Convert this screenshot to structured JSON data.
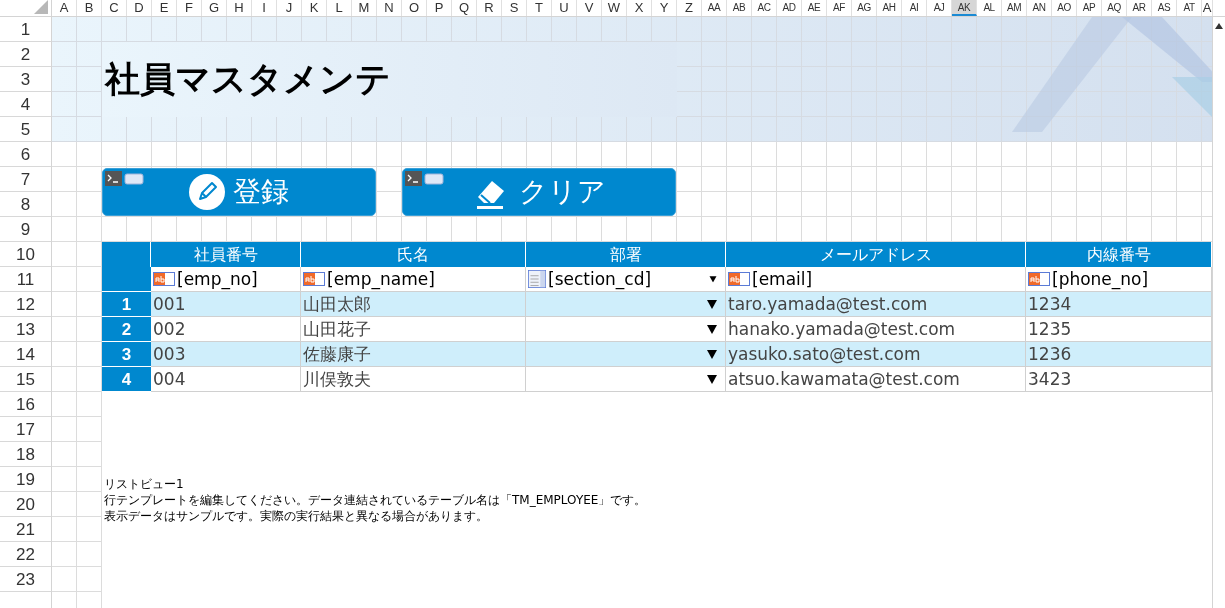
{
  "sheet": {
    "columns": [
      {
        "label": "A",
        "selected": false
      },
      {
        "label": "B",
        "selected": false
      },
      {
        "label": "C",
        "selected": false
      },
      {
        "label": "D",
        "selected": false
      },
      {
        "label": "E",
        "selected": false
      },
      {
        "label": "F",
        "selected": false
      },
      {
        "label": "G",
        "selected": false
      },
      {
        "label": "H",
        "selected": false
      },
      {
        "label": "I",
        "selected": false
      },
      {
        "label": "J",
        "selected": false
      },
      {
        "label": "K",
        "selected": false
      },
      {
        "label": "L",
        "selected": false
      },
      {
        "label": "M",
        "selected": false
      },
      {
        "label": "N",
        "selected": false
      },
      {
        "label": "O",
        "selected": false
      },
      {
        "label": "P",
        "selected": false
      },
      {
        "label": "Q",
        "selected": false
      },
      {
        "label": "R",
        "selected": false
      },
      {
        "label": "S",
        "selected": false
      },
      {
        "label": "T",
        "selected": false
      },
      {
        "label": "U",
        "selected": false
      },
      {
        "label": "V",
        "selected": false
      },
      {
        "label": "W",
        "selected": false
      },
      {
        "label": "X",
        "selected": false
      },
      {
        "label": "Y",
        "selected": false
      },
      {
        "label": "Z",
        "selected": false
      },
      {
        "label": "AA",
        "selected": false
      },
      {
        "label": "AB",
        "selected": false
      },
      {
        "label": "AC",
        "selected": false
      },
      {
        "label": "AD",
        "selected": false
      },
      {
        "label": "AE",
        "selected": false
      },
      {
        "label": "AF",
        "selected": false
      },
      {
        "label": "AG",
        "selected": false
      },
      {
        "label": "AH",
        "selected": false
      },
      {
        "label": "AI",
        "selected": false
      },
      {
        "label": "AJ",
        "selected": false
      },
      {
        "label": "AK",
        "selected": true
      },
      {
        "label": "AL",
        "selected": false
      },
      {
        "label": "AM",
        "selected": false
      },
      {
        "label": "AN",
        "selected": false
      },
      {
        "label": "AO",
        "selected": false
      },
      {
        "label": "AP",
        "selected": false
      },
      {
        "label": "AQ",
        "selected": false
      },
      {
        "label": "AR",
        "selected": false
      },
      {
        "label": "AS",
        "selected": false
      },
      {
        "label": "AT",
        "selected": false
      },
      {
        "label": "A",
        "selected": false
      }
    ],
    "rows": [
      "1",
      "2",
      "3",
      "4",
      "5",
      "6",
      "7",
      "8",
      "9",
      "10",
      "11",
      "12",
      "13",
      "14",
      "15",
      "16",
      "17",
      "18",
      "19",
      "20",
      "21",
      "22",
      "23"
    ]
  },
  "title": "社員マスタメンテ",
  "buttons": [
    {
      "label": "登録",
      "kind": "pencil"
    },
    {
      "label": "クリア",
      "kind": "eraser"
    }
  ],
  "list_view": {
    "columns": [
      {
        "label": "社員番号",
        "kind": "text",
        "template": "[emp_no]"
      },
      {
        "label": "氏名",
        "kind": "text",
        "template": "[emp_name]"
      },
      {
        "label": "部署",
        "kind": "combo",
        "template": "[section_cd]"
      },
      {
        "label": "メールアドレス",
        "kind": "text",
        "template": "[email]"
      },
      {
        "label": "内線番号",
        "kind": "text",
        "template": "[phone_no]"
      }
    ],
    "rows": [
      {
        "number": "1",
        "cells": [
          "001",
          "山田太郎",
          null,
          "taro.yamada@test.com",
          "1234"
        ]
      },
      {
        "number": "2",
        "cells": [
          "002",
          "山田花子",
          null,
          "hanako.yamada@test.com",
          "1235"
        ]
      },
      {
        "number": "3",
        "cells": [
          "003",
          "佐藤康子",
          null,
          "yasuko.sato@test.com",
          "1236"
        ]
      },
      {
        "number": "4",
        "cells": [
          "004",
          "川俣敦夫",
          null,
          "atsuo.kawamata@test.com",
          "3423"
        ]
      }
    ],
    "caption": "リストビュー1",
    "notes": [
      "行テンプレートを編集してください。データ連結されているテーブル名は「TM_EMPLOYEE」です。",
      "表示データはサンプルです。実際の実行結果と異なる場合があります。"
    ]
  }
}
